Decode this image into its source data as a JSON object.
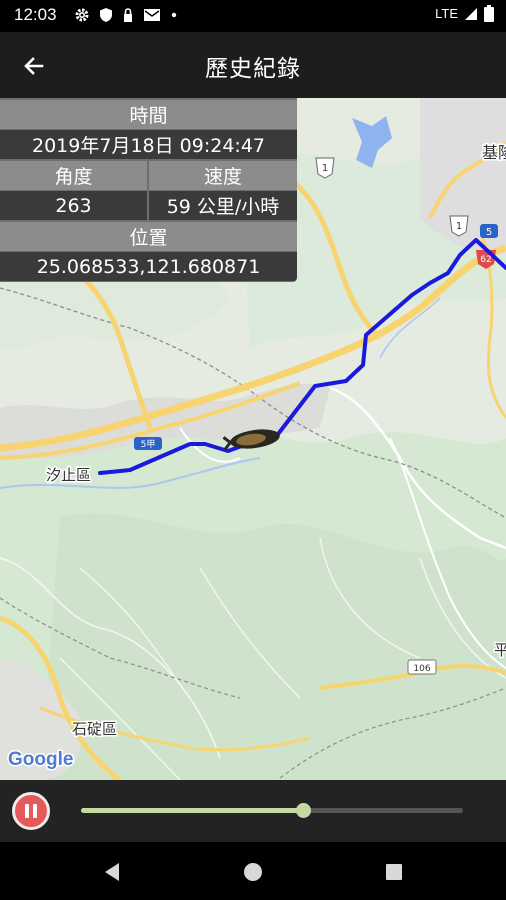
{
  "status_bar": {
    "time": "12:03",
    "network": "LTE",
    "icons": [
      "gear-icon",
      "shield-icon",
      "lock-icon",
      "mail-icon",
      "dot-icon",
      "signal-icon",
      "battery-icon"
    ]
  },
  "header": {
    "title": "歷史紀錄",
    "back_icon": "arrow-left-icon"
  },
  "info": {
    "time_label": "時間",
    "time_value": "2019年7月18日 09:24:47",
    "angle_label": "角度",
    "angle_value": "263",
    "speed_label": "速度",
    "speed_value": "59 公里/小時",
    "position_label": "位置",
    "position_value": "25.068533,121.680871"
  },
  "map": {
    "labels": {
      "xizhi": "汐止區",
      "shiding": "石碇區",
      "keelung": "基隆",
      "ping": "平",
      "google": "Google"
    },
    "road_signs": {
      "r5_a": "5",
      "r5_b": "5",
      "r62": "62",
      "r1_a": "1",
      "r1_b": "1",
      "r5_bypass": "5甲",
      "t106": "106"
    },
    "route_color": "#1a1adb",
    "vehicle_icon": "car-icon"
  },
  "player": {
    "progress": 0.58,
    "state": "playing",
    "button_icon": "pause-icon",
    "accent": "#c5d9a2"
  },
  "nav": {
    "back_icon": "nav-back-icon",
    "home_icon": "nav-home-icon",
    "recents_icon": "nav-recents-icon"
  }
}
